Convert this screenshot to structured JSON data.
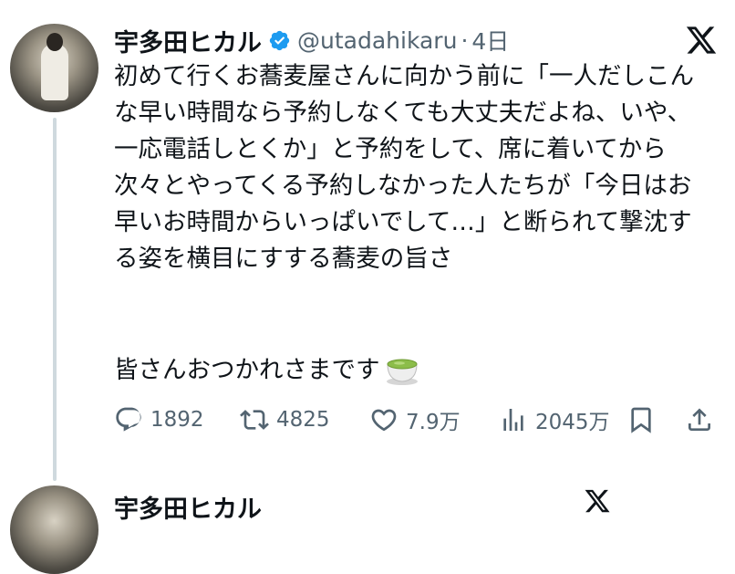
{
  "tweet": {
    "display_name": "宇多田ヒカル",
    "handle": "@utadahikaru",
    "separator": "·",
    "time": "4日",
    "text": "初めて行くお蕎麦屋さんに向かう前に「一人だしこんな早い時間なら予約しなくても大丈夫だよね、いや、一応電話しとくか」と予約をして、席に着いてから次々とやってくる予約しなかった人たちが「今日はお早いお時間からいっぱいでして…」と断られて撃沈する姿を横目にすする蕎麦の旨さ",
    "greeting": "皆さんおつかれさまです",
    "greeting_emoji": "tea-cup-emoji"
  },
  "actions": {
    "replies": "1892",
    "reposts": "4825",
    "likes": "7.9万",
    "views": "2045万"
  },
  "next_tweet": {
    "display_name": "宇多田ヒカル"
  },
  "colors": {
    "text": "#0f1419",
    "secondary": "#536471",
    "verified": "#1d9bf0",
    "thread_line": "#cfd9de"
  },
  "icons": [
    "verified-badge-icon",
    "x-logo-icon",
    "reply-icon",
    "repost-icon",
    "like-icon",
    "views-icon",
    "bookmark-icon",
    "share-icon"
  ]
}
